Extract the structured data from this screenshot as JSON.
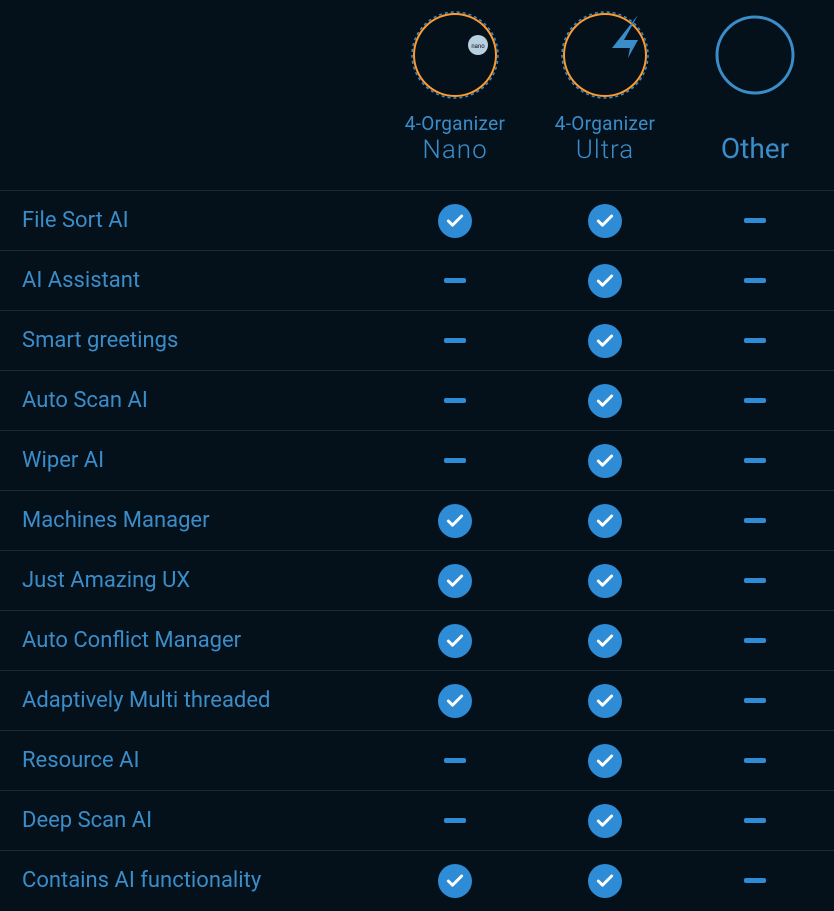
{
  "columns": [
    {
      "brand": "4-Organizer",
      "tier": "Nano"
    },
    {
      "brand": "4-Organizer",
      "tier": "Ultra"
    },
    {
      "label": "Other"
    }
  ],
  "features": [
    {
      "label": "File Sort AI",
      "values": [
        "check",
        "check",
        "dash"
      ]
    },
    {
      "label": "AI Assistant",
      "values": [
        "dash",
        "check",
        "dash"
      ]
    },
    {
      "label": "Smart greetings",
      "values": [
        "dash",
        "check",
        "dash"
      ]
    },
    {
      "label": "Auto Scan AI",
      "values": [
        "dash",
        "check",
        "dash"
      ]
    },
    {
      "label": "Wiper AI",
      "values": [
        "dash",
        "check",
        "dash"
      ]
    },
    {
      "label": "Machines Manager",
      "values": [
        "check",
        "check",
        "dash"
      ]
    },
    {
      "label": "Just Amazing UX",
      "values": [
        "check",
        "check",
        "dash"
      ]
    },
    {
      "label": "Auto Conflict Manager",
      "values": [
        "check",
        "check",
        "dash"
      ]
    },
    {
      "label": "Adaptively Multi threaded",
      "values": [
        "check",
        "check",
        "dash"
      ]
    },
    {
      "label": "Resource AI",
      "values": [
        "dash",
        "check",
        "dash"
      ]
    },
    {
      "label": "Deep Scan AI",
      "values": [
        "dash",
        "check",
        "dash"
      ]
    },
    {
      "label": "Contains AI functionality",
      "values": [
        "check",
        "check",
        "dash"
      ]
    }
  ]
}
